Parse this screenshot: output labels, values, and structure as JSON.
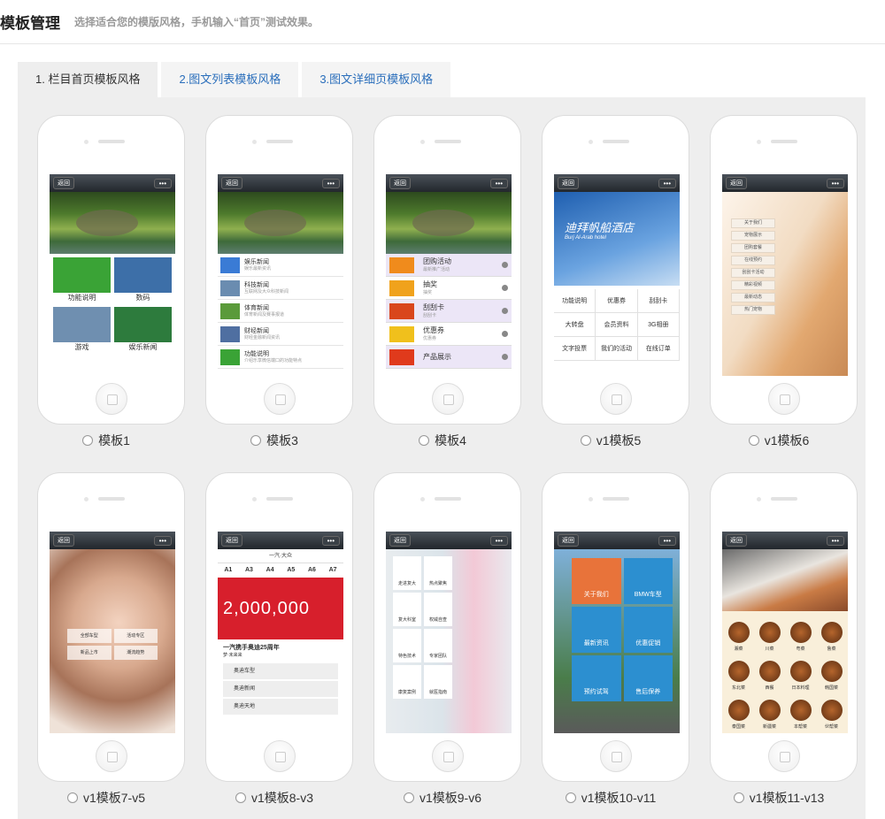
{
  "header": {
    "title": "模板管理",
    "subtitle": "选择适合您的模版风格，手机输入“首页”测试效果。"
  },
  "tabs": [
    {
      "label": "1. 栏目首页模板风格",
      "active": true
    },
    {
      "label": "2.图文列表模板风格",
      "active": false
    },
    {
      "label": "3.图文详细页模板风格",
      "active": false
    }
  ],
  "phone_ui": {
    "back": "返回",
    "more": "•••"
  },
  "templates": [
    {
      "name": "模板1",
      "selected": false,
      "screen": {
        "tiles": [
          "功能说明",
          "数码",
          "游戏",
          "娱乐新闻"
        ]
      }
    },
    {
      "name": "模板3",
      "selected": false,
      "screen": {
        "rows": [
          {
            "title": "娱乐新闻",
            "sub": "娱乐最新资讯"
          },
          {
            "title": "科技新闻",
            "sub": "互联网及大众科技新闻"
          },
          {
            "title": "体育新闻",
            "sub": "体育新闻及赛事报道"
          },
          {
            "title": "财经新闻",
            "sub": "财经金融新闻资讯"
          },
          {
            "title": "功能说明",
            "sub": "介绍乐享微信端口的功能特点"
          }
        ]
      }
    },
    {
      "name": "模板4",
      "selected": false,
      "screen": {
        "rows": [
          {
            "title": "团购活动",
            "sub": "最新推广活动"
          },
          {
            "title": "抽奖",
            "sub": "抽奖"
          },
          {
            "title": "刮刮卡",
            "sub": "刮刮卡"
          },
          {
            "title": "优惠券",
            "sub": "优惠券"
          },
          {
            "title": "产品展示",
            "sub": ""
          }
        ]
      }
    },
    {
      "name": "v1模板5",
      "selected": false,
      "screen": {
        "hero_title": "迪拜帆船酒店",
        "hero_sub": "Burj Al-Arab hotel",
        "cells": [
          "功能说明",
          "优惠券",
          "刮刮卡",
          "大转盘",
          "会员资料",
          "3G相册",
          "文字投票",
          "我们的活动",
          "在线订单"
        ]
      }
    },
    {
      "name": "v1模板6",
      "selected": false,
      "screen": {
        "buttons": [
          "关于我们",
          "宠物展示",
          "团购套餐",
          "在线预约",
          "刮刮卡活动",
          "精彩视频",
          "最新动态",
          "热门宠物"
        ]
      }
    },
    {
      "name": "v1模板7-v5",
      "selected": false,
      "screen": {
        "buttons": [
          "全部车型",
          "活动专区",
          "新品上市",
          "潮流趋势"
        ]
      }
    },
    {
      "name": "v1模板8-v3",
      "selected": false,
      "screen": {
        "brand": "一汽·大众",
        "models": [
          "A1",
          "A3",
          "A4",
          "A5",
          "A6",
          "A7"
        ],
        "banner_number": "2,000,000",
        "headline": "一汽携手奥迪25周年",
        "sub": "梦·未来来",
        "links": [
          "奥迪车型",
          "奥迪新闻",
          "奥迪天地"
        ]
      }
    },
    {
      "name": "v1模板9-v6",
      "selected": false,
      "screen": {
        "items": [
          "走进复大",
          "热点聚焦",
          "复大科室",
          "权威自查",
          "特色技术",
          "专家团队",
          "康复案例",
          "就医指南"
        ]
      }
    },
    {
      "name": "v1模板10-v11",
      "selected": false,
      "screen": {
        "tiles": [
          {
            "label": "关于我们",
            "color": "#e8733a"
          },
          {
            "label": "BMW车型",
            "color": "#2c8fd0"
          },
          {
            "label": "最新资讯",
            "color": "#2c8fd0"
          },
          {
            "label": "优惠促销",
            "color": "#2c8fd0"
          },
          {
            "label": "预约试驾",
            "color": "#2c8fd0"
          },
          {
            "label": "售后保养",
            "color": "#2c8fd0"
          }
        ]
      }
    },
    {
      "name": "v1模板11-v13",
      "selected": false,
      "screen": {
        "foods": [
          "湘菜",
          "川菜",
          "粤菜",
          "鲁菜",
          "东北菜",
          "西餐",
          "日本料理",
          "韩国菜",
          "泰国菜",
          "新疆菜",
          "本帮菜",
          "伙帮菜"
        ]
      }
    }
  ]
}
